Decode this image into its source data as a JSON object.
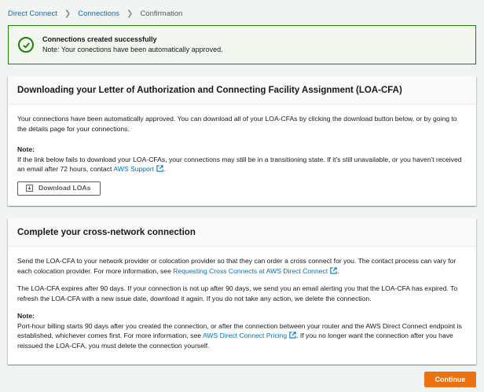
{
  "breadcrumb": {
    "items": [
      "Direct Connect",
      "Connections"
    ],
    "current": "Confirmation"
  },
  "flash": {
    "title": "Connections created successfully",
    "text": "Note: Your conections have been automatically approved.",
    "color": "#1d8102"
  },
  "loa_card": {
    "title": "Downloading your Letter of Authorization and Connecting Facility Assignment (LOA-CFA)",
    "intro": "Your connections have been automatically approved. You can download all of your LOA-CFAs by clicking the download button below, or by going to the details page for your connections.",
    "note_label": "Note:",
    "note_text": "If the link below fails to download your LOA-CFAs, your connections may still be in a transitioning state. If it's still unavailable, or you haven't received an email after 72 hours, contact",
    "support_link": "AWS Support",
    "note_end": ".",
    "download_button": "Download LOAs"
  },
  "cross_card": {
    "title": "Complete your cross-network connection",
    "p1_text": "Send the LOA-CFA to your network provider or colocation provider so that they can order a cross connect for you. The contact process can vary for each colocation provider. For more information, see",
    "p1_link": "Requesting Cross Connects at AWS Direct Connect",
    "p1_end": ".",
    "p2_text": "The LOA-CFA expires after 90 days. If your connection is not up after 90 days, we send you an email alerting you that the LOA-CFA has expired. To refresh the LOA-CFA with a new issue date, download it again. If you do not take any action, we delete the connection.",
    "note_label": "Note:",
    "note_text": "Port-hour billing starts 90 days after you created the connection, or after the connection between your router and the AWS Direct Connect endpoint is established, whichever comes first. For more information, see",
    "note_link": "AWS Direct Connect Pricing",
    "note_end": ". If you no longer want the connection after you have reissued the LOA-CFA, you must delete the connection yourself."
  },
  "continue_button": "Continue",
  "colors": {
    "accent": "#ec7211",
    "link": "#0073bb",
    "success": "#1d8102"
  }
}
